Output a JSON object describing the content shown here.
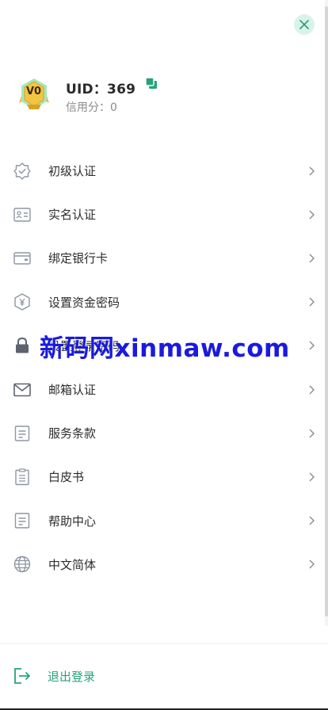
{
  "profile": {
    "badge_text": "V0",
    "uid": "UID：369",
    "credit": "信用分：0"
  },
  "menu": [
    {
      "label": "初级认证",
      "icon": "shield-check-icon"
    },
    {
      "label": "实名认证",
      "icon": "id-card-icon"
    },
    {
      "label": "绑定银行卡",
      "icon": "wallet-card-icon"
    },
    {
      "label": "设置资金密码",
      "icon": "yuan-shield-icon"
    },
    {
      "label": "设置登录密码",
      "icon": "lock-icon"
    },
    {
      "label": "邮箱认证",
      "icon": "mail-icon"
    },
    {
      "label": "服务条款",
      "icon": "document-icon"
    },
    {
      "label": "白皮书",
      "icon": "clipboard-icon"
    },
    {
      "label": "帮助中心",
      "icon": "help-document-icon"
    },
    {
      "label": "中文简体",
      "icon": "globe-icon"
    }
  ],
  "watermark": "新码网xinmaw.com",
  "logout": {
    "label": "退出登录"
  },
  "colors": {
    "accent": "#27a37a",
    "close_bg": "#d9f3ea",
    "icon_gray": "#8e95a3",
    "watermark": "#1a1adf"
  }
}
